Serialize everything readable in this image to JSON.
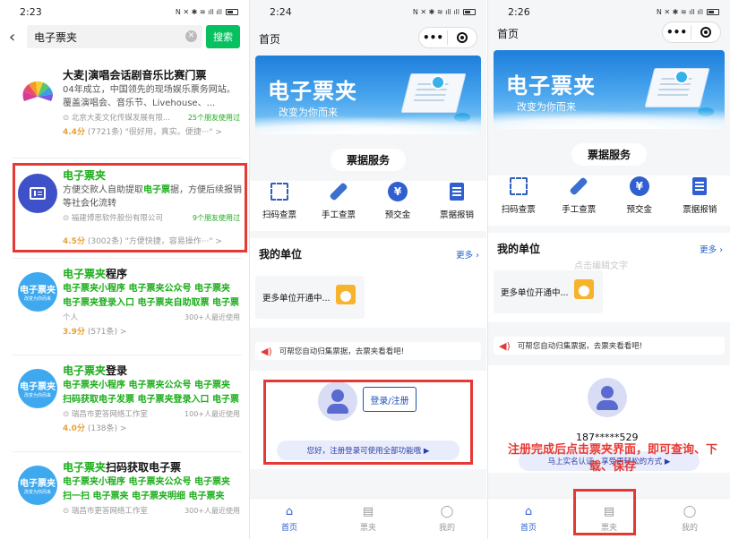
{
  "panel1": {
    "time": "2:23",
    "search_query": "电子票夹",
    "search_button": "搜索",
    "results": [
      {
        "title": "大麦|演唱会话剧音乐比赛门票",
        "desc": "04年成立，中国领先的现场娱乐票务网站。覆盖演唱会、音乐节、Livehouse、...",
        "company": "北京大麦文化传媒发展有限...",
        "friends": "25个朋友使用过",
        "score": "4.4分",
        "rating_rest": "(7721条) \"很好用，真实。便捷···\" >"
      },
      {
        "title": "电子票夹",
        "desc_pre": "方便交款人自助提取",
        "desc_hl": "电子票",
        "desc_post": "据，方便后续报销等社会化流转",
        "company": "福建博思软件股份有限公司",
        "friends": "9个朋友使用过",
        "score": "4.5分",
        "rating_rest": "(3002条) \"方便快捷，容易操作···\" >"
      },
      {
        "title_hl": "电子票夹",
        "title_rest": "程序",
        "line1": "电子票夹小程序 电子票夹公众号 电子票夹",
        "line2": "电子票夹登录入口 电子票夹自助取票 电子票",
        "company": "个人",
        "friends": "300+人最近使用",
        "score": "3.9分",
        "rating_rest": "(571条) >"
      },
      {
        "title_hl": "电子票夹",
        "title_rest": "登录",
        "line1": "电子票夹小程序 电子票夹公众号 电子票夹",
        "line2": "扫码获取电子发票 电子票夹登录入口 电子票",
        "company": "瑞昌市更答网络工作室",
        "friends": "100+人最近使用",
        "score": "4.0分",
        "rating_rest": "(138条) >"
      },
      {
        "title_hl": "电子票夹",
        "title_rest": "扫码获取电子票",
        "line1": "电子票夹小程序 电子票夹公众号 电子票夹",
        "line2": "扫一扫 电子票夹 电子票夹明细 电子票夹",
        "company": "瑞昌市更答网络工作室",
        "friends": "300+人最近使用"
      }
    ],
    "logo_text": "电子票夹",
    "logo_sub": "改变为你而来"
  },
  "panel2": {
    "time": "2:24",
    "page_title": "首页",
    "banner_title": "电子票夹",
    "banner_sub": "改变为你而来",
    "services_title": "票据服务",
    "services": [
      "扫码查票",
      "手工查票",
      "预交金",
      "票据报销"
    ],
    "units_title": "我的单位",
    "more": "更多",
    "unit_card": "更多单位开通中...",
    "notice": "可帮您自动归集票据，去票夹看看吧!",
    "login_button": "登录/注册",
    "login_tip": "您好，注册登录可使用全部功能哦 ▶",
    "tabs": [
      "首页",
      "票夹",
      "我的"
    ]
  },
  "panel3": {
    "time": "2:26",
    "page_title": "首页",
    "banner_title": "电子票夹",
    "banner_sub": "改变为你而来",
    "services_title": "票据服务",
    "services": [
      "扫码查票",
      "手工查票",
      "预交金",
      "票据报销"
    ],
    "units_title": "我的单位",
    "more": "更多",
    "ghost_text": "点击编辑文字",
    "unit_card": "更多单位开通中...",
    "notice": "可帮您自动归集票据，去票夹看看吧!",
    "phone": "187*****529",
    "tip_partial": "马上实名认证，享受更轻松的方式 ▶",
    "annotation": "注册完成后点击票夹界面，即可查询、下载、保存",
    "tabs": [
      "首页",
      "票夹",
      "我的"
    ]
  },
  "colors": {
    "accent_green": "#07c160",
    "highlight_red": "#e53935",
    "brand_blue": "#2f5fd0"
  }
}
